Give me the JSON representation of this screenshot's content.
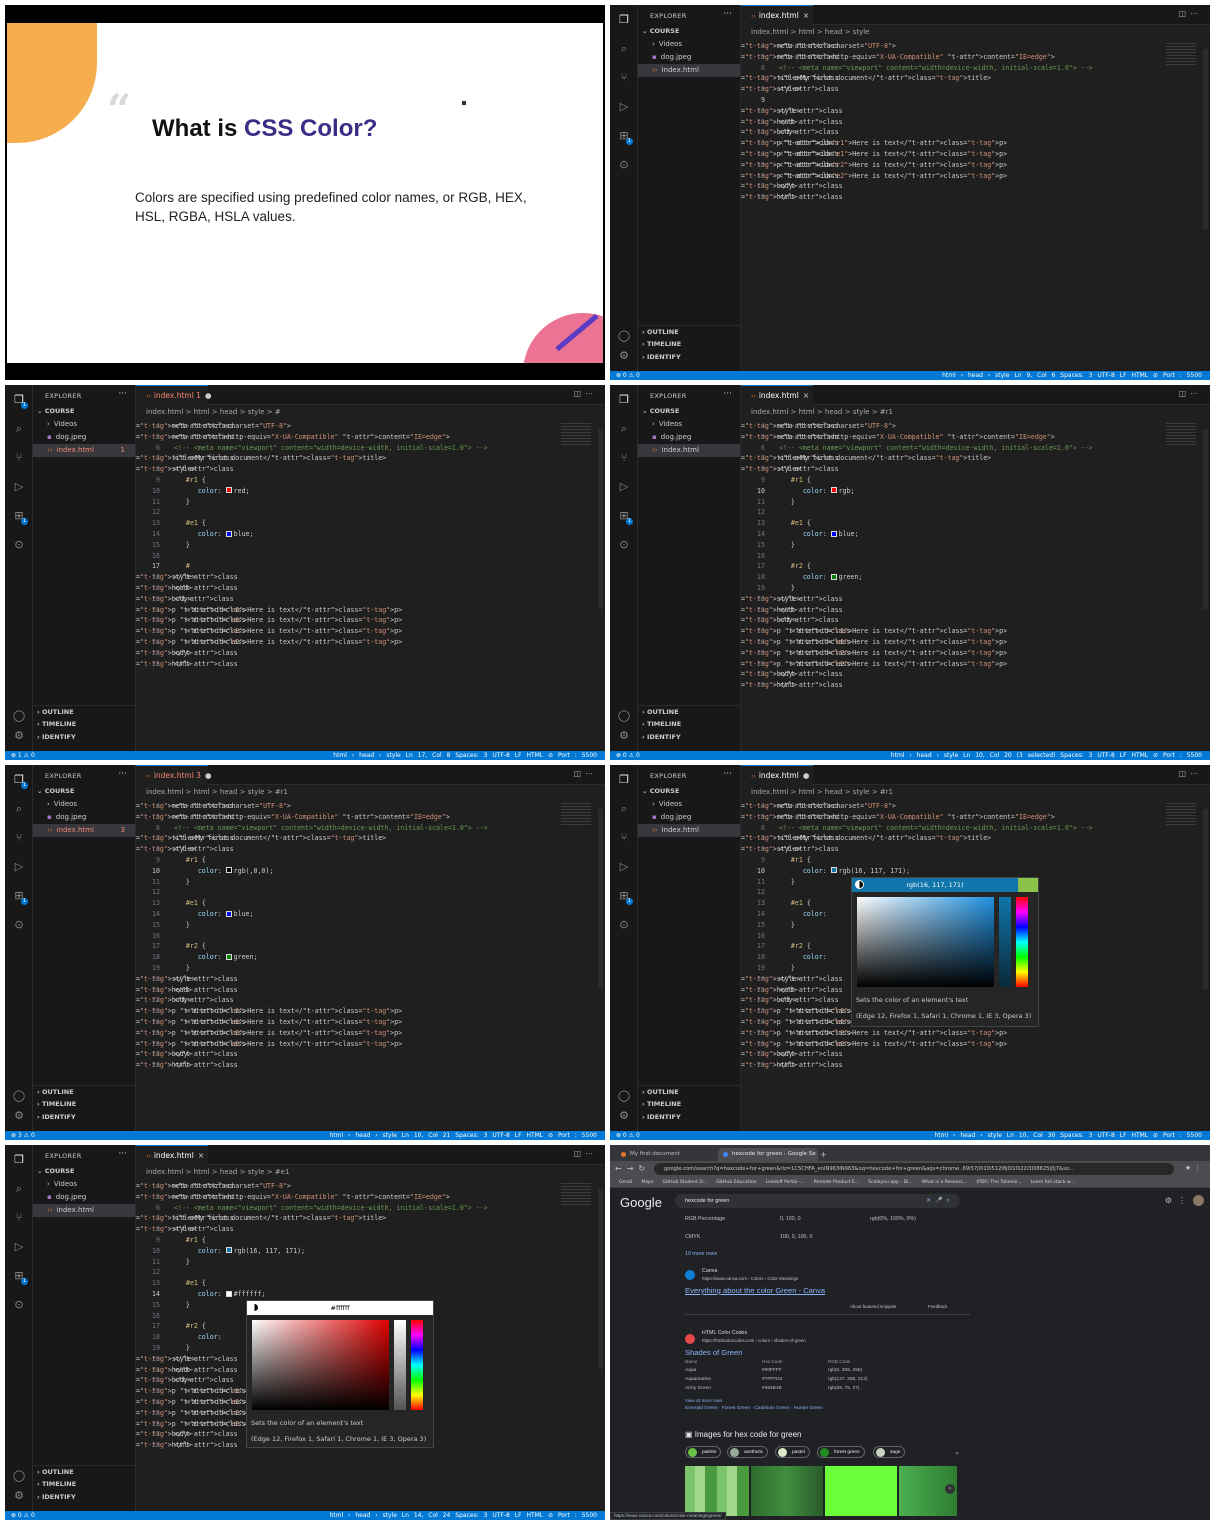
{
  "slide": {
    "title_prefix": "What is ",
    "title_accent": "CSS Color?",
    "body": "Colors are specified using predefined color names, or RGB, HEX, HSL, RGBA, HSLA values."
  },
  "explorer": {
    "title": "EXPLORER",
    "more": "···",
    "section": "COURSE",
    "items": [
      "Videos",
      "dog.jpeg",
      "index.html"
    ],
    "bottom_sections": [
      "OUTLINE",
      "TIMELINE",
      "IDENTIFY"
    ]
  },
  "breadcrumb_base": "index.html  >  html  >  head  >  style",
  "icons": {
    "explorer": "files-icon",
    "search": "search-icon",
    "source_control": "source-control-icon",
    "run_debug": "run-debug-icon",
    "extensions": "extensions-icon",
    "remote": "remote-icon",
    "account": "account-icon",
    "settings": "gear-icon"
  },
  "frames": [
    {
      "tab_label": "index.html",
      "tab_mark": "×",
      "breadcrumb_suffix": "",
      "status_left": "⊗ 0 ⚠ 0",
      "status_right": "html › head › style    Ln 9, Col 6    Spaces: 3    UTF-8    LF    HTML    ⊘ Port : 5500",
      "line_start": 4,
      "lines": [
        "<meta charset=\"UTF-8\">",
        "<meta http-equiv=\"X-UA-Compatible\" content=\"IE=edge\">",
        "<!-- <meta name=\"viewport\" content=\"width=device-width, initial-scale=1.0\"> -->",
        "<title>My first document</title>",
        "<style>",
        "",
        "</style>",
        "</head>",
        "<body>",
        "<p id=\"r1\">Here is text</p>",
        "<p id=\"e1\">Here is text</p>",
        "<p id=\"r2\">Here is text</p>",
        "<p id=\"e2\">Here is text</p>",
        "</body>",
        "</html>"
      ]
    },
    {
      "tab_label": "index.html 1",
      "tab_mark": "●",
      "breadcrumb_suffix": "  >  #",
      "explorer_badge": "1",
      "status_left": "⊗ 1 ⚠ 0",
      "status_right": "html › head › style    Ln 17, Col 8    Spaces: 3    UTF-8    LF    HTML    ⊘ Port : 5500",
      "line_start": 4,
      "lines": [
        "<meta charset=\"UTF-8\">",
        "<meta http-equiv=\"X-UA-Compatible\" content=\"IE=edge\">",
        "<!-- <meta name=\"viewport\" content=\"width=device-width, initial-scale=1.0\"> -->",
        "<title>My first document</title>",
        "<style>",
        "   #r1 {",
        "      color: red;",
        "   }",
        "",
        "   #e1 {",
        "      color: blue;",
        "   }",
        "",
        "   #",
        "</style>",
        "</head>",
        "<body>",
        "   <p id=\"r1\">Here is text</p>",
        "   <p id=\"e1\">Here is text</p>",
        "   <p id=\"r2\">Here is text</p>",
        "   <p id=\"e2\">Here is text</p>",
        "</body>",
        "</html>"
      ]
    },
    {
      "tab_label": "index.html",
      "tab_mark": "×",
      "breadcrumb_suffix": "  >  #r1",
      "status_left": "⊗ 0 ⚠ 0",
      "status_right": "html › head › style    Ln 10, Col 20 (3 selected)    Spaces: 3    UTF-8    LF    HTML    ⊘ Port : 5500",
      "line_start": 4,
      "lines": [
        "<meta charset=\"UTF-8\">",
        "<meta http-equiv=\"X-UA-Compatible\" content=\"IE=edge\">",
        "<!-- <meta name=\"viewport\" content=\"width=device-width, initial-scale=1.0\"> -->",
        "<title>My first document</title>",
        "<style>",
        "   #r1 {",
        "      color: rgb;",
        "   }",
        "",
        "   #e1 {",
        "      color: blue;",
        "   }",
        "",
        "   #r2 {",
        "      color: green;",
        "   }",
        "</style>",
        "</head>",
        "<body>",
        "   <p id=\"r1\">Here is text</p>",
        "   <p id=\"e1\">Here is text</p>",
        "   <p id=\"r2\">Here is text</p>",
        "   <p id=\"e2\">Here is text</p>",
        "</body>",
        "</html>"
      ]
    },
    {
      "tab_label": "index.html 3",
      "tab_mark": "●",
      "breadcrumb_suffix": "  >  #r1",
      "explorer_badge": "3",
      "status_left": "⊗ 3 ⚠ 0",
      "status_right": "html › head › style    Ln 10, Col 21    Spaces: 3    UTF-8    LF    HTML    ⊘ Port : 5500",
      "line_start": 4,
      "lines": [
        "<meta charset=\"UTF-8\">",
        "<meta http-equiv=\"X-UA-Compatible\" content=\"IE=edge\">",
        "<!-- <meta name=\"viewport\" content=\"width=device-width, initial-scale=1.0\"> -->",
        "<title>My first document</title>",
        "<style>",
        "   #r1 {",
        "      color: rgb(,0,0);",
        "   }",
        "",
        "   #e1 {",
        "      color: blue;",
        "   }",
        "",
        "   #r2 {",
        "      color: green;",
        "   }",
        "</style>",
        "</head>",
        "<body>",
        "   <p id=\"r1\">Here is text</p>",
        "   <p id=\"e1\">Here is text</p>",
        "   <p id=\"r2\">Here is text</p>",
        "   <p id=\"e2\">Here is text</p>",
        "</body>",
        "</html>"
      ]
    },
    {
      "tab_label": "index.html",
      "tab_mark": "●",
      "breadcrumb_suffix": "  >  #r1",
      "status_left": "⊗ 0 ⚠ 0",
      "status_right": "html › head › style    Ln 10, Col 30    Spaces: 3    UTF-8    LF    HTML    ⊘ Port : 5500",
      "line_start": 4,
      "picker_value": "rgb(16, 117, 171)",
      "picker_desc": "Sets the color of an element's text",
      "picker_compat": "(Edge 12, Firefox 1, Safari 1, Chrome 1, IE 3, Opera 3)",
      "lines": [
        "<meta charset=\"UTF-8\">",
        "<meta http-equiv=\"X-UA-Compatible\" content=\"IE=edge\">",
        "<!-- <meta name=\"viewport\" content=\"width=device-width, initial-scale=1.0\"> -->",
        "<title>My first document</title>",
        "<style>",
        "   #r1 {",
        "      color: rgb(16, 117, 171);",
        "   }",
        "",
        "   #e1 {",
        "      color: ",
        "   }",
        "",
        "   #r2 {",
        "      color: ",
        "   }",
        "</style>",
        "</head>",
        "<body>",
        "   <p id=\"r1\">Her",
        "   <p id=\"e1\">Her",
        "   <p id=\"r2\">Here is text</p>",
        "   <p id=\"e2\">Here is text</p>",
        "</body>",
        "</html>"
      ]
    },
    {
      "tab_label": "index.html",
      "tab_mark": "×",
      "breadcrumb_suffix": "  >  #e1",
      "status_left": "⊗ 0 ⚠ 0",
      "status_right": "html › head › style    Ln 14, Col 24    Spaces: 3    UTF-8    LF    HTML    ⊘ Port : 5500",
      "line_start": 4,
      "picker_value": "#ffffff",
      "picker_desc": "Sets the color of an element's text",
      "picker_compat": "(Edge 12, Firefox 1, Safari 1, Chrome 1, IE 3, Opera 3)",
      "lines": [
        "<meta charset=\"UTF-8\">",
        "<meta http-equiv=\"X-UA-Compatible\" content=\"IE=edge\">",
        "<!-- <meta name=\"viewport\" content=\"width=device-width, initial-scale=1.0\"> -->",
        "<title>My first document</title>",
        "<style>",
        "   #r1 {",
        "      color: rgb(16, 117, 171);",
        "   }",
        "",
        "   #e1 {",
        "      color: #ffffff;",
        "   }",
        "",
        "   #r2 {",
        "      color: ",
        "   }",
        "</style>",
        "</head>",
        "<body>",
        "   <p id=\"r1\">Her",
        "   <p id=\"e1\">Her",
        "   <p id=\"r2\">Her",
        "   <p id=\"e2\">Her",
        "</body>",
        "</html>"
      ]
    }
  ],
  "browser": {
    "tabs": [
      "My first document",
      "hexcode for green - Google Se"
    ],
    "new_tab": "+",
    "url": "google.com/search?q=hexcode+for+green&rlz=1C5CHFA_enIN963IN963&oq=hexcode+for+green&aqs=chrome..69i57j0i10i512l8j0i10i22i30l8625j0j7&so...",
    "bookmarks": [
      "Gmail",
      "Maps",
      "GitHub Student D...",
      "GitHub Education",
      "Leadoff Portal -...",
      "Remote Product E...",
      "Scaleyou app - Di...",
      "What is a Researc...",
      "(PDF) The Tokeniz...",
      "Learn full stack w..."
    ],
    "logo": "Google",
    "query": "hexcode for green",
    "table_rows": [
      [
        "RGB Percentage",
        "0, 100, 0",
        "rgb(0%, 100%, 0%)"
      ],
      [
        "CMYK",
        "100, 0, 100, 0",
        ""
      ]
    ],
    "more_rows": "10 more rows",
    "result1": {
      "site": "Canva",
      "path": "https://www.canva.com › Colors › Color Meanings",
      "title": "Everything about the color Green - Canva",
      "featured": "About featured snippets",
      "feedback": "Feedback"
    },
    "result2": {
      "site": "HTML Color Codes",
      "path": "https://htmlcolorcodes.com › colors › shades-of-green",
      "title": "Shades of Green",
      "headers": [
        "Name",
        "Hex Code",
        "RGB Code"
      ],
      "rows": [
        [
          "Aqua",
          "#00FFFF",
          "rgb(0, 255, 255)"
        ],
        [
          "Aquamarine",
          "#7FFFD4",
          "rgb(127, 255, 212)"
        ],
        [
          "Army Green",
          "#454B1B",
          "rgb(69, 75, 27)"
        ]
      ],
      "more": "View 44 more rows",
      "sublinks": "Emerald Green · Forest Green · Cadmium Green · Hunter Green"
    },
    "images_heading": "Images for hex code for green",
    "chips": [
      "palette",
      "aesthetic",
      "pastel",
      "forest green",
      "sage"
    ],
    "chip_colors": [
      "#6cc04a",
      "#9aa89a",
      "#d9e8c9",
      "#228b22",
      "#c9d3c0"
    ],
    "status_url": "https://www.canva.com/colors/color-meanings/green/"
  }
}
